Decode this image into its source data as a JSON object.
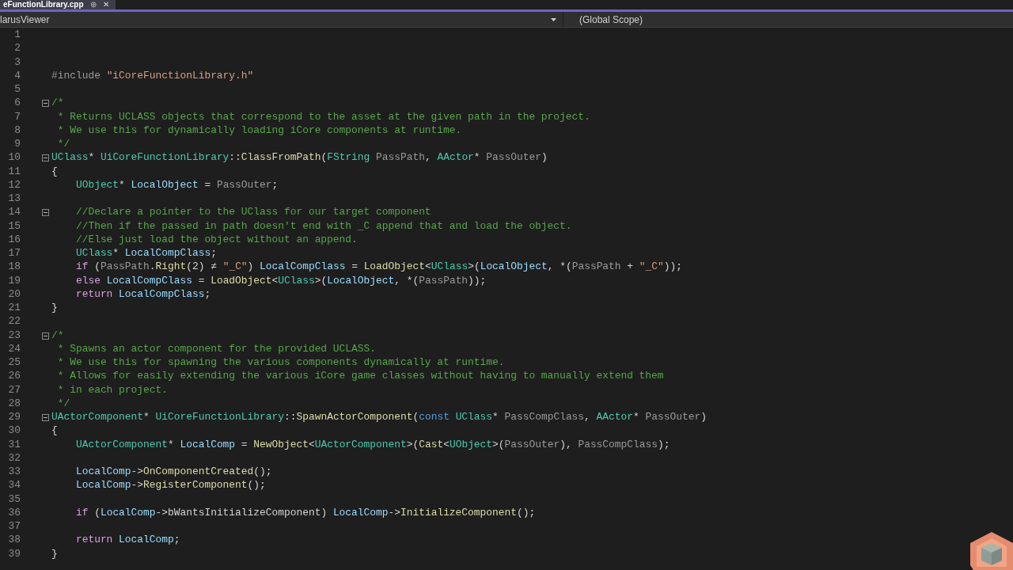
{
  "tab": {
    "title": "eFunctionLibrary.cpp",
    "pin": "⊕",
    "close": "✕"
  },
  "nav": {
    "project": "larusViewer",
    "scope": "(Global Scope)"
  },
  "lines": [
    {
      "number": "1"
    },
    {
      "number": "2"
    },
    {
      "number": "3"
    },
    {
      "number": "4",
      "tokens": [
        {
          "kind": "pp",
          "text": "#include "
        },
        {
          "kind": "str",
          "text": "\"iCoreFunctionLibrary.h\""
        }
      ]
    },
    {
      "number": "5"
    },
    {
      "number": "6",
      "expanded": true,
      "tokens": [
        {
          "kind": "cm",
          "text": "/*"
        }
      ]
    },
    {
      "number": "7",
      "tokens": [
        {
          "kind": "cm",
          "text": " * Returns UCLASS objects that correspond to the asset at the given path in the project."
        }
      ]
    },
    {
      "number": "8",
      "tokens": [
        {
          "kind": "cm",
          "text": " * We use this for dynamically loading iCore components at runtime."
        }
      ]
    },
    {
      "number": "9",
      "tokens": [
        {
          "kind": "cm",
          "text": " */"
        }
      ]
    },
    {
      "number": "10",
      "expanded": true,
      "tokens": [
        {
          "kind": "ty",
          "text": "UClass"
        },
        {
          "kind": "p",
          "text": "* "
        },
        {
          "kind": "ty",
          "text": "UiCoreFunctionLibrary"
        },
        {
          "kind": "p",
          "text": "::"
        },
        {
          "kind": "fn",
          "text": "ClassFromPath"
        },
        {
          "kind": "p",
          "text": "("
        },
        {
          "kind": "ty",
          "text": "FString"
        },
        {
          "kind": "prm",
          "text": " PassPath"
        },
        {
          "kind": "p",
          "text": ", "
        },
        {
          "kind": "ty",
          "text": "AActor"
        },
        {
          "kind": "p",
          "text": "* "
        },
        {
          "kind": "prm",
          "text": "PassOuter"
        },
        {
          "kind": "p",
          "text": ")"
        }
      ]
    },
    {
      "number": "11",
      "tokens": [
        {
          "kind": "p",
          "text": "{"
        }
      ]
    },
    {
      "number": "12",
      "indented": true,
      "tokens": [
        {
          "kind": "ty",
          "text": "UObject"
        },
        {
          "kind": "p",
          "text": "* "
        },
        {
          "kind": "var",
          "text": "LocalObject"
        },
        {
          "kind": "p",
          "text": " = "
        },
        {
          "kind": "prm",
          "text": "PassOuter"
        },
        {
          "kind": "p",
          "text": ";"
        }
      ]
    },
    {
      "number": "13"
    },
    {
      "number": "14",
      "expanded": true,
      "indented": true,
      "tokens": [
        {
          "kind": "cm",
          "text": "//Declare a pointer to the UClass for our target component"
        }
      ]
    },
    {
      "number": "15",
      "indented": true,
      "tokens": [
        {
          "kind": "cm",
          "text": "//Then if the passed in path doesn't end with _C append that and load the object."
        }
      ]
    },
    {
      "number": "16",
      "indented": true,
      "tokens": [
        {
          "kind": "cm",
          "text": "//Else just load the object without an append."
        }
      ]
    },
    {
      "number": "17",
      "indented": true,
      "tokens": [
        {
          "kind": "ty",
          "text": "UClass"
        },
        {
          "kind": "p",
          "text": "* "
        },
        {
          "kind": "var",
          "text": "LocalCompClass"
        },
        {
          "kind": "p",
          "text": ";"
        }
      ]
    },
    {
      "number": "18",
      "indented": true,
      "tokens": [
        {
          "kind": "kw",
          "text": "if"
        },
        {
          "kind": "p",
          "text": " ("
        },
        {
          "kind": "prm",
          "text": "PassPath"
        },
        {
          "kind": "p",
          "text": "."
        },
        {
          "kind": "fn",
          "text": "Right"
        },
        {
          "kind": "p",
          "text": "(2) ≠ "
        },
        {
          "kind": "str",
          "text": "\"_C\""
        },
        {
          "kind": "p",
          "text": ") "
        },
        {
          "kind": "var",
          "text": "LocalCompClass"
        },
        {
          "kind": "p",
          "text": " = "
        },
        {
          "kind": "fn",
          "text": "LoadObject"
        },
        {
          "kind": "p",
          "text": "<"
        },
        {
          "kind": "ty",
          "text": "UClass"
        },
        {
          "kind": "p",
          "text": ">("
        },
        {
          "kind": "var",
          "text": "LocalObject"
        },
        {
          "kind": "p",
          "text": ", *("
        },
        {
          "kind": "prm",
          "text": "PassPath"
        },
        {
          "kind": "p",
          "text": " + "
        },
        {
          "kind": "str",
          "text": "\"_C\""
        },
        {
          "kind": "p",
          "text": "));"
        }
      ]
    },
    {
      "number": "19",
      "indented": true,
      "tokens": [
        {
          "kind": "kw",
          "text": "else"
        },
        {
          "kind": "var",
          "text": " LocalCompClass"
        },
        {
          "kind": "p",
          "text": " = "
        },
        {
          "kind": "fn",
          "text": "LoadObject"
        },
        {
          "kind": "p",
          "text": "<"
        },
        {
          "kind": "ty",
          "text": "UClass"
        },
        {
          "kind": "p",
          "text": ">("
        },
        {
          "kind": "var",
          "text": "LocalObject"
        },
        {
          "kind": "p",
          "text": ", *("
        },
        {
          "kind": "prm",
          "text": "PassPath"
        },
        {
          "kind": "p",
          "text": "));"
        }
      ]
    },
    {
      "number": "20",
      "indented": true,
      "tokens": [
        {
          "kind": "kw",
          "text": "return"
        },
        {
          "kind": "var",
          "text": " LocalCompClass"
        },
        {
          "kind": "p",
          "text": ";"
        }
      ]
    },
    {
      "number": "21",
      "tokens": [
        {
          "kind": "p",
          "text": "}"
        }
      ]
    },
    {
      "number": "22"
    },
    {
      "number": "23",
      "expanded": true,
      "tokens": [
        {
          "kind": "cm",
          "text": "/*"
        }
      ]
    },
    {
      "number": "24",
      "tokens": [
        {
          "kind": "cm",
          "text": " * Spawns an actor component for the provided UCLASS."
        }
      ]
    },
    {
      "number": "25",
      "tokens": [
        {
          "kind": "cm",
          "text": " * We use this for spawning the various components dynamically at runtime."
        }
      ]
    },
    {
      "number": "26",
      "tokens": [
        {
          "kind": "cm",
          "text": " * Allows for easily extending the various iCore game classes without having to manually extend them"
        }
      ]
    },
    {
      "number": "27",
      "tokens": [
        {
          "kind": "cm",
          "text": " * in each project."
        }
      ]
    },
    {
      "number": "28",
      "tokens": [
        {
          "kind": "cm",
          "text": " */"
        }
      ]
    },
    {
      "number": "29",
      "expanded": true,
      "tokens": [
        {
          "kind": "ty",
          "text": "UActorComponent"
        },
        {
          "kind": "p",
          "text": "* "
        },
        {
          "kind": "ty",
          "text": "UiCoreFunctionLibrary"
        },
        {
          "kind": "p",
          "text": "::"
        },
        {
          "kind": "fn",
          "text": "SpawnActorComponent"
        },
        {
          "kind": "p",
          "text": "("
        },
        {
          "kind": "kb",
          "text": "const"
        },
        {
          "kind": "ty",
          "text": " UClass"
        },
        {
          "kind": "p",
          "text": "* "
        },
        {
          "kind": "prm",
          "text": "PassCompClass"
        },
        {
          "kind": "p",
          "text": ", "
        },
        {
          "kind": "ty",
          "text": "AActor"
        },
        {
          "kind": "p",
          "text": "* "
        },
        {
          "kind": "prm",
          "text": "PassOuter"
        },
        {
          "kind": "p",
          "text": ")"
        }
      ]
    },
    {
      "number": "30",
      "tokens": [
        {
          "kind": "p",
          "text": "{"
        }
      ]
    },
    {
      "number": "31",
      "indented": true,
      "tokens": [
        {
          "kind": "ty",
          "text": "UActorComponent"
        },
        {
          "kind": "p",
          "text": "* "
        },
        {
          "kind": "var",
          "text": "LocalComp"
        },
        {
          "kind": "p",
          "text": " = "
        },
        {
          "kind": "fn",
          "text": "NewObject"
        },
        {
          "kind": "p",
          "text": "<"
        },
        {
          "kind": "ty",
          "text": "UActorComponent"
        },
        {
          "kind": "p",
          "text": ">("
        },
        {
          "kind": "fn",
          "text": "Cast"
        },
        {
          "kind": "p",
          "text": "<"
        },
        {
          "kind": "ty",
          "text": "UObject"
        },
        {
          "kind": "p",
          "text": ">("
        },
        {
          "kind": "prm",
          "text": "PassOuter"
        },
        {
          "kind": "p",
          "text": "), "
        },
        {
          "kind": "prm",
          "text": "PassCompClass"
        },
        {
          "kind": "p",
          "text": ");"
        }
      ]
    },
    {
      "number": "32"
    },
    {
      "number": "33",
      "indented": true,
      "tokens": [
        {
          "kind": "var",
          "text": "LocalComp"
        },
        {
          "kind": "p",
          "text": "->"
        },
        {
          "kind": "fn",
          "text": "OnComponentCreated"
        },
        {
          "kind": "p",
          "text": "();"
        }
      ]
    },
    {
      "number": "34",
      "indented": true,
      "tokens": [
        {
          "kind": "var",
          "text": "LocalComp"
        },
        {
          "kind": "p",
          "text": "->"
        },
        {
          "kind": "fn",
          "text": "RegisterComponent"
        },
        {
          "kind": "p",
          "text": "();"
        }
      ]
    },
    {
      "number": "35"
    },
    {
      "number": "36",
      "indented": true,
      "tokens": [
        {
          "kind": "kw",
          "text": "if"
        },
        {
          "kind": "p",
          "text": " ("
        },
        {
          "kind": "var",
          "text": "LocalComp"
        },
        {
          "kind": "p",
          "text": "->bWantsInitializeComponent) "
        },
        {
          "kind": "var",
          "text": "LocalComp"
        },
        {
          "kind": "p",
          "text": "->"
        },
        {
          "kind": "fn",
          "text": "InitializeComponent"
        },
        {
          "kind": "p",
          "text": "();"
        }
      ]
    },
    {
      "number": "37"
    },
    {
      "number": "38",
      "indented": true,
      "tokens": [
        {
          "kind": "kw",
          "text": "return"
        },
        {
          "kind": "var",
          "text": " LocalComp"
        },
        {
          "kind": "p",
          "text": ";"
        }
      ]
    },
    {
      "number": "39",
      "tokens": [
        {
          "kind": "p",
          "text": "}"
        }
      ]
    }
  ]
}
